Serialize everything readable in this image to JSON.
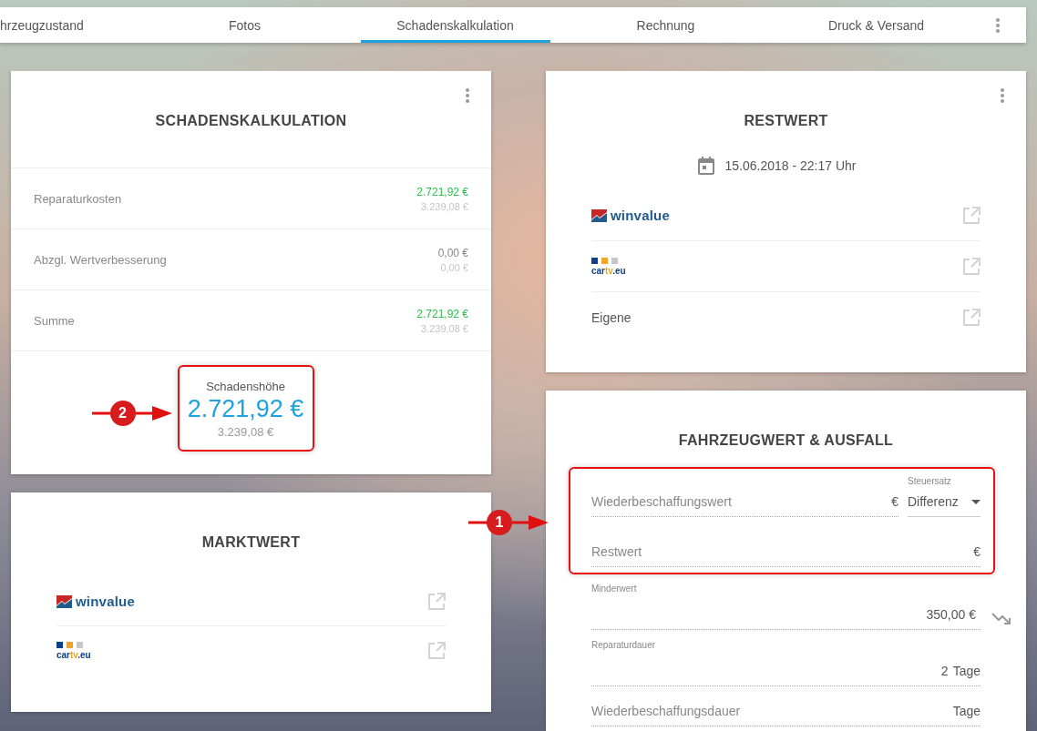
{
  "tabs": [
    {
      "label": "hrzeugzustand",
      "selected": false
    },
    {
      "label": "Fotos",
      "selected": false
    },
    {
      "label": "Schadenskalkulation",
      "selected": true
    },
    {
      "label": "Rechnung",
      "selected": false
    },
    {
      "label": "Druck & Versand",
      "selected": false
    }
  ],
  "calculation": {
    "title": "SCHADENSKALKULATION",
    "rows": [
      {
        "label": "Reparaturkosten",
        "value": "2.721,92 €",
        "value_positive": true,
        "secondary": "3.239,08 €"
      },
      {
        "label": "Abzgl. Wertverbesserung",
        "value": "0,00 €",
        "value_positive": false,
        "secondary": "0,00 €"
      },
      {
        "label": "Summe",
        "value": "2.721,92 €",
        "value_positive": true,
        "secondary": "3.239,08 €"
      }
    ],
    "summary": {
      "label": "Schadenshöhe",
      "value": "2.721,92 €",
      "secondary": "3.239,08 €",
      "callout": "2"
    }
  },
  "market_value": {
    "title": "MARKTWERT",
    "providers": [
      {
        "kind": "winvalue",
        "text": "winvalue"
      },
      {
        "kind": "cartv",
        "parts": [
          "car",
          "tv",
          ".eu"
        ]
      }
    ]
  },
  "residual_value": {
    "title": "RESTWERT",
    "date": "15.06.2018 - 22:17 Uhr",
    "providers": [
      {
        "kind": "winvalue",
        "text": "winvalue"
      },
      {
        "kind": "cartv",
        "parts": [
          "car",
          "tv",
          ".eu"
        ]
      },
      {
        "kind": "plain",
        "text": "Eigene"
      }
    ]
  },
  "vehicle_value": {
    "title": "FAHRZEUGWERT & AUSFALL",
    "callout": "1",
    "highlighted_fields": [
      {
        "kind": "placeholder",
        "placeholder": "Wiederbeschaffungswert",
        "unit": "€",
        "select": {
          "label": "Steuersatz",
          "value": "Differenz"
        }
      },
      {
        "kind": "placeholder",
        "placeholder": "Restwert",
        "unit": "€"
      }
    ],
    "fields": [
      {
        "kind": "labeled",
        "label": "Minderwert",
        "value": "350,00 €",
        "trend": true
      },
      {
        "kind": "labeled",
        "label": "Reparaturdauer",
        "value": "2",
        "unit": "Tage"
      },
      {
        "kind": "placeholder",
        "placeholder": "Wiederbeschaffungsdauer",
        "unit": "Tage"
      }
    ]
  }
}
